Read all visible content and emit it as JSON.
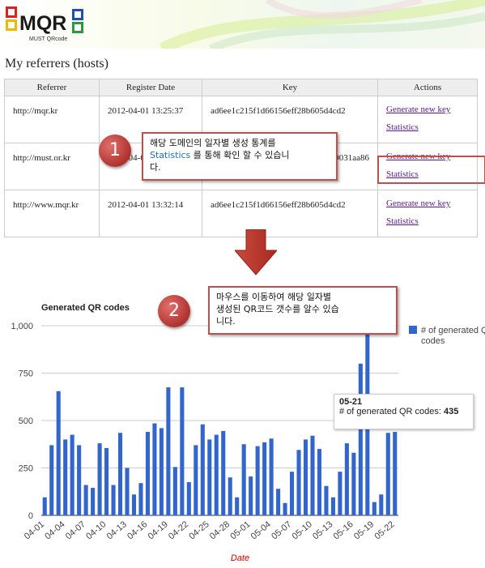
{
  "header": {
    "logo_text": "MQR",
    "logo_subtext": "MUST QRcode"
  },
  "page_title": "My referrers (hosts)",
  "table": {
    "columns": [
      "Referrer",
      "Register Date",
      "Key",
      "Actions"
    ],
    "rows": [
      {
        "referrer": "http://mqr.kr",
        "date": "2012-04-01 13:25:37",
        "key": "ad6ee1c215f1d66156eff28b605d4cd2",
        "action1": "Generate new key",
        "action2": "Statistics"
      },
      {
        "referrer": "http://must.or.kr",
        "date": "2012-04-01 13:31:0",
        "key": "9031aa86",
        "action1": "Generate new key",
        "action2": "Statistics"
      },
      {
        "referrer": "http://www.mqr.kr",
        "date": "2012-04-01 13:32:14",
        "key": "ad6ee1c215f1d66156eff28b605d4cd2",
        "action1": "Generate new key",
        "action2": "Statistics"
      }
    ]
  },
  "callout1": {
    "number": "1",
    "line1": "해당 도메인의 일자별 생성 통계를",
    "link_word": "Statistics",
    "line2_rest": " 를 통해 확인 할 수 있습니",
    "line3": "다."
  },
  "callout2": {
    "number": "2",
    "line1": "마우스를 이동하여 해당 일자별",
    "line2": "생성된 QR코드 갯수를 알수 있습",
    "line3": "니다."
  },
  "tooltip": {
    "date": "05-21",
    "label": "# of generated QR codes: ",
    "value": "435"
  },
  "colors": {
    "bar": "#3366cc",
    "callout_border": "#c0504d",
    "arrow": "#c0392b",
    "link": "#551a8b",
    "axis_title": "#cc0000"
  },
  "chart_data": {
    "type": "bar",
    "title": "Generated QR codes",
    "xlabel": "Date",
    "ylabel": "",
    "ylim": [
      0,
      1000
    ],
    "y_ticks": [
      "0",
      "250",
      "500",
      "750",
      "1,000"
    ],
    "x_tick_labels": [
      "04-01",
      "04-04",
      "04-07",
      "04-10",
      "04-13",
      "04-16",
      "04-19",
      "04-22",
      "04-25",
      "04-28",
      "05-01",
      "05-04",
      "05-07",
      "05-10",
      "05-13",
      "05-16",
      "05-19",
      "05-22"
    ],
    "legend": "right",
    "categories": [
      "04-01",
      "04-02",
      "04-03",
      "04-04",
      "04-05",
      "04-06",
      "04-07",
      "04-08",
      "04-09",
      "04-10",
      "04-11",
      "04-12",
      "04-13",
      "04-14",
      "04-15",
      "04-16",
      "04-17",
      "04-18",
      "04-19",
      "04-20",
      "04-21",
      "04-22",
      "04-23",
      "04-24",
      "04-25",
      "04-26",
      "04-27",
      "04-28",
      "04-29",
      "04-30",
      "05-01",
      "05-02",
      "05-03",
      "05-04",
      "05-05",
      "05-06",
      "05-07",
      "05-08",
      "05-09",
      "05-10",
      "05-11",
      "05-12",
      "05-13",
      "05-14",
      "05-15",
      "05-16",
      "05-17",
      "05-18",
      "05-19",
      "05-20",
      "05-21",
      "05-22"
    ],
    "series": [
      {
        "name": "# of generated QR codes",
        "values": [
          95,
          370,
          655,
          400,
          425,
          370,
          160,
          145,
          380,
          355,
          160,
          435,
          250,
          110,
          170,
          440,
          485,
          460,
          675,
          255,
          675,
          175,
          370,
          480,
          400,
          425,
          445,
          200,
          95,
          375,
          205,
          365,
          385,
          405,
          140,
          65,
          230,
          345,
          400,
          420,
          350,
          155,
          95,
          230,
          380,
          330,
          800,
          1000,
          70,
          110,
          435,
          440
        ]
      }
    ]
  }
}
